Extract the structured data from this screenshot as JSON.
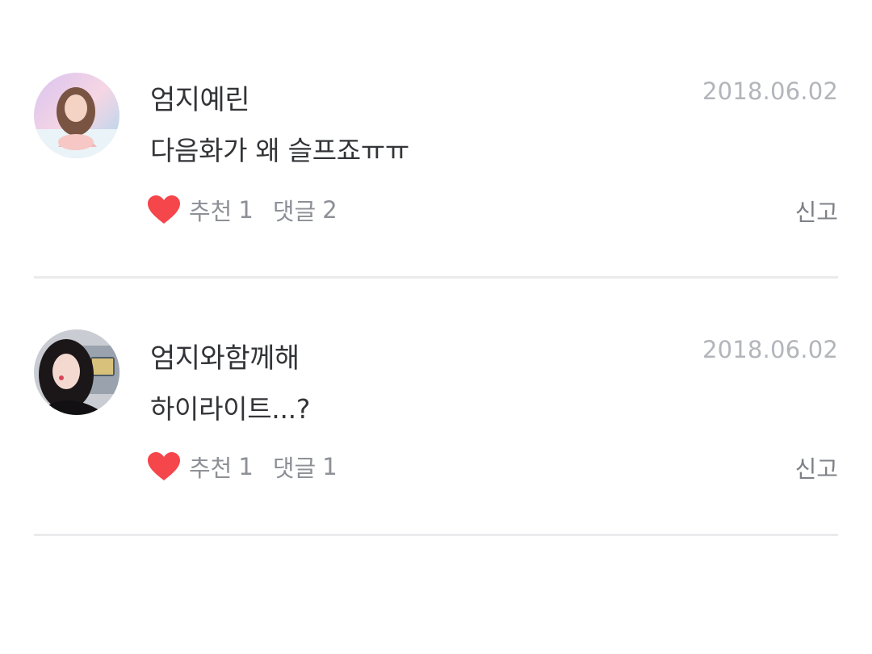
{
  "comments": [
    {
      "username": "엄지예린",
      "date": "2018.06.02",
      "text": "다음화가 왜 슬프죠ㅠㅠ",
      "like_label": "추천",
      "like_count": "1",
      "reply_label": "댓글",
      "reply_count": "2",
      "report_label": "신고",
      "avatar_icon": "user-avatar-photo"
    },
    {
      "username": "엄지와함께해",
      "date": "2018.06.02",
      "text": "하이라이트...?",
      "like_label": "추천",
      "like_count": "1",
      "reply_label": "댓글",
      "reply_count": "1",
      "report_label": "신고",
      "avatar_icon": "user-avatar-photo"
    }
  ],
  "colors": {
    "heart": "#f5464b",
    "text_primary": "#333438",
    "text_secondary": "#8d9096",
    "date": "#b2b5ba",
    "divider": "#ebebed"
  },
  "icons": {
    "heart": "heart-icon"
  }
}
